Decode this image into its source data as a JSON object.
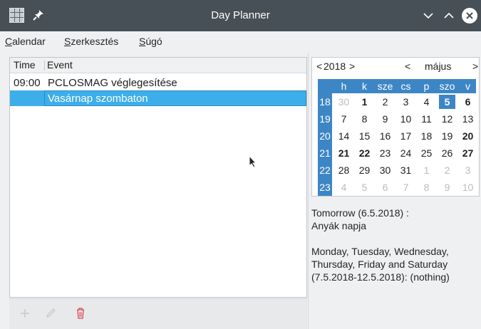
{
  "window": {
    "title": "Day Planner",
    "titlebar_color": "#475057"
  },
  "menu": {
    "items": [
      {
        "mnemonic": "C",
        "rest": "alendar"
      },
      {
        "mnemonic": "S",
        "rest": "zerkesztés"
      },
      {
        "mnemonic": "S",
        "rest": "úgó"
      }
    ]
  },
  "list": {
    "columns": [
      "Time",
      "Event"
    ],
    "rows": [
      {
        "time": "09:00",
        "event": "PCLOSMAG véglegesítése",
        "selected": false
      },
      {
        "time": "",
        "event": "Vasárnap szombaton",
        "selected": true
      }
    ]
  },
  "toolbar": {
    "icons": [
      "add-icon",
      "edit-icon",
      "delete-icon"
    ]
  },
  "calendar": {
    "year_prev": "<",
    "year": "2018",
    "year_next": ">",
    "month_prev": "<",
    "month": "május",
    "month_next": ">",
    "weekday_headers": [
      "h",
      "k",
      "sze",
      "cs",
      "p",
      "szo",
      "v"
    ],
    "weeks": [
      {
        "week": "18",
        "days": [
          "30",
          "1",
          "2",
          "3",
          "4",
          "5",
          "6"
        ]
      },
      {
        "week": "19",
        "days": [
          "7",
          "8",
          "9",
          "10",
          "11",
          "12",
          "13"
        ]
      },
      {
        "week": "20",
        "days": [
          "14",
          "15",
          "16",
          "17",
          "18",
          "19",
          "20"
        ]
      },
      {
        "week": "21",
        "days": [
          "21",
          "22",
          "23",
          "24",
          "25",
          "26",
          "27"
        ]
      },
      {
        "week": "22",
        "days": [
          "28",
          "29",
          "30",
          "31",
          "1",
          "2",
          "3"
        ]
      },
      {
        "week": "23",
        "days": [
          "4",
          "5",
          "6",
          "7",
          "8",
          "9",
          "10"
        ]
      }
    ],
    "selected_day": "5",
    "accent_color": "#3d86c6"
  },
  "info": {
    "line1": "Tomorrow (6.5.2018) :",
    "line2": "Anyák napja",
    "line3": "Monday, Tuesday, Wednesday,",
    "line4": "Thursday, Friday and Saturday",
    "line5": "(7.5.2018-12.5.2018): (nothing)"
  }
}
